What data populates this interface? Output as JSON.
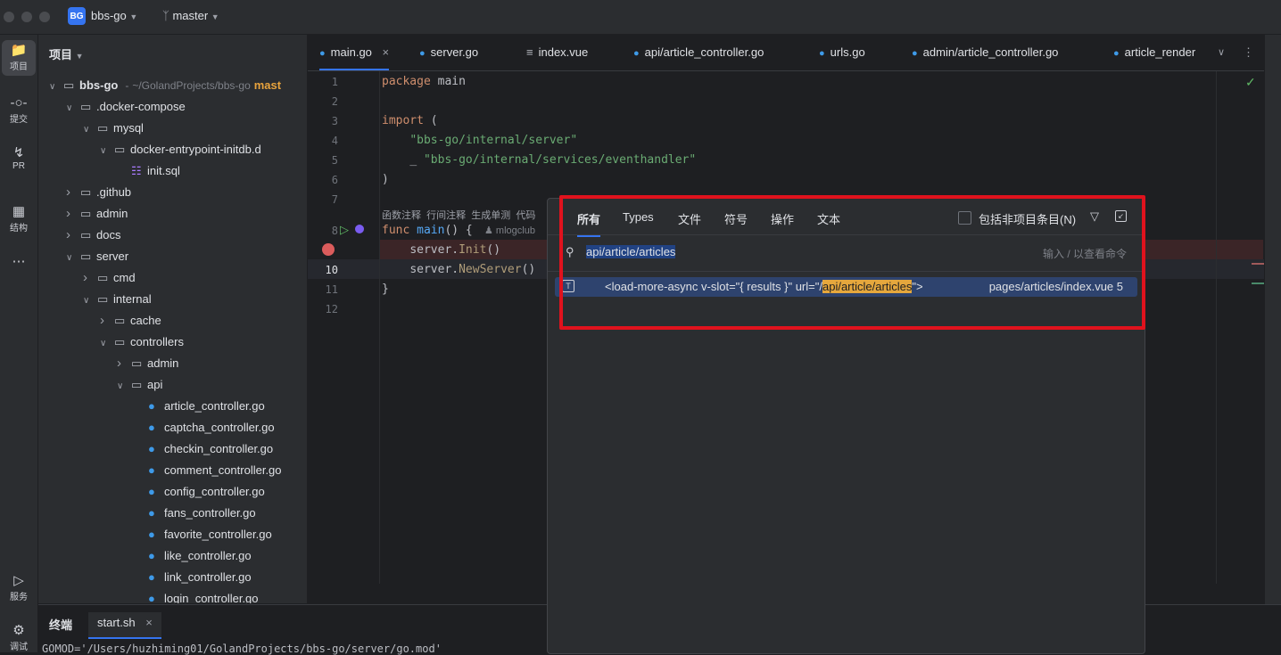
{
  "titlebar": {
    "project_badge": "BG",
    "project_name": "bbs-go",
    "branch": "master"
  },
  "toolstrip": [
    {
      "label": "项目",
      "icon": "folder-icon"
    },
    {
      "label": "提交",
      "icon": "commit-icon"
    },
    {
      "label": "PR",
      "icon": "pull-request-icon"
    },
    {
      "label": "结构",
      "icon": "structure-icon"
    },
    {
      "label": "服务",
      "icon": "services-icon"
    },
    {
      "label": "调试",
      "icon": "debug-icon"
    }
  ],
  "project_panel": {
    "title": "项目",
    "tree": [
      {
        "label": "bbs-go",
        "depth": 0,
        "open": true,
        "type": "folder",
        "path": "~/GolandProjects/bbs-go",
        "branch": "mast"
      },
      {
        "label": ".docker-compose",
        "depth": 1,
        "open": true,
        "type": "folder"
      },
      {
        "label": "mysql",
        "depth": 2,
        "open": true,
        "type": "folder"
      },
      {
        "label": "docker-entrypoint-initdb.d",
        "depth": 3,
        "open": true,
        "type": "folder"
      },
      {
        "label": "init.sql",
        "depth": 4,
        "type": "sql"
      },
      {
        "label": ".github",
        "depth": 1,
        "open": false,
        "type": "folder"
      },
      {
        "label": "admin",
        "depth": 1,
        "open": false,
        "type": "folder"
      },
      {
        "label": "docs",
        "depth": 1,
        "open": false,
        "type": "folder"
      },
      {
        "label": "server",
        "depth": 1,
        "open": true,
        "type": "folder"
      },
      {
        "label": "cmd",
        "depth": 2,
        "open": false,
        "type": "folder"
      },
      {
        "label": "internal",
        "depth": 2,
        "open": true,
        "type": "folder"
      },
      {
        "label": "cache",
        "depth": 3,
        "open": false,
        "type": "folder"
      },
      {
        "label": "controllers",
        "depth": 3,
        "open": true,
        "type": "folder"
      },
      {
        "label": "admin",
        "depth": 4,
        "open": false,
        "type": "folder"
      },
      {
        "label": "api",
        "depth": 4,
        "open": true,
        "type": "folder"
      },
      {
        "label": "article_controller.go",
        "depth": 5,
        "type": "go"
      },
      {
        "label": "captcha_controller.go",
        "depth": 5,
        "type": "go"
      },
      {
        "label": "checkin_controller.go",
        "depth": 5,
        "type": "go"
      },
      {
        "label": "comment_controller.go",
        "depth": 5,
        "type": "go"
      },
      {
        "label": "config_controller.go",
        "depth": 5,
        "type": "go"
      },
      {
        "label": "fans_controller.go",
        "depth": 5,
        "type": "go"
      },
      {
        "label": "favorite_controller.go",
        "depth": 5,
        "type": "go"
      },
      {
        "label": "like_controller.go",
        "depth": 5,
        "type": "go"
      },
      {
        "label": "link_controller.go",
        "depth": 5,
        "type": "go"
      },
      {
        "label": "login_controller.go",
        "depth": 5,
        "type": "go"
      }
    ]
  },
  "editor_tabs": [
    {
      "label": "main.go",
      "active": true,
      "closable": true
    },
    {
      "label": "server.go"
    },
    {
      "label": "index.vue"
    },
    {
      "label": "api/article_controller.go"
    },
    {
      "label": "urls.go"
    },
    {
      "label": "admin/article_controller.go"
    },
    {
      "label": "article_render"
    }
  ],
  "code": {
    "line_numbers": [
      "1",
      "2",
      "3",
      "4",
      "5",
      "6",
      "7",
      "8",
      "9",
      "10",
      "11",
      "12"
    ],
    "l1_kw": "package",
    "l1_rest": " main",
    "l3_kw": "import",
    "l3_rest": " (",
    "l4": "\"bbs-go/internal/server\"",
    "l5_blank": "_ ",
    "l5": "\"bbs-go/internal/services/eventhandler\"",
    "l6": ")",
    "inlay_hints": "函数注释  行间注释  生成单测  代码",
    "l8_kw": "func",
    "l8_fn": "main",
    "l8_rest": "() {",
    "author_hint": "mlogclub",
    "l9_pkg": "server.",
    "l9_call": "Init",
    "l9_rest": "()",
    "l10_pkg": "server.",
    "l10_call": "NewServer",
    "l10_rest": "()",
    "l11": "}"
  },
  "search_popup": {
    "tabs": [
      "所有",
      "Types",
      "文件",
      "符号",
      "操作",
      "文本"
    ],
    "include_non_project": "包括非项目条目(N)",
    "query": "api/article/articles",
    "hint": "输入 / 以查看命令",
    "result": {
      "prefix": "<load-more-async v-slot=\"{ results }\" url=\"/",
      "match": "api/article/articles",
      "suffix": "\">",
      "location": "pages/articles/index.vue 5"
    }
  },
  "bottom_panel": {
    "tabs": [
      "终端",
      "start.sh"
    ],
    "output": "GOMOD='/Users/huzhiming01/GolandProjects/bbs-go/server/go.mod'"
  },
  "colors": {
    "accent": "#3574f0",
    "highlight_box": "#e0121d",
    "match": "#e5a73d"
  }
}
